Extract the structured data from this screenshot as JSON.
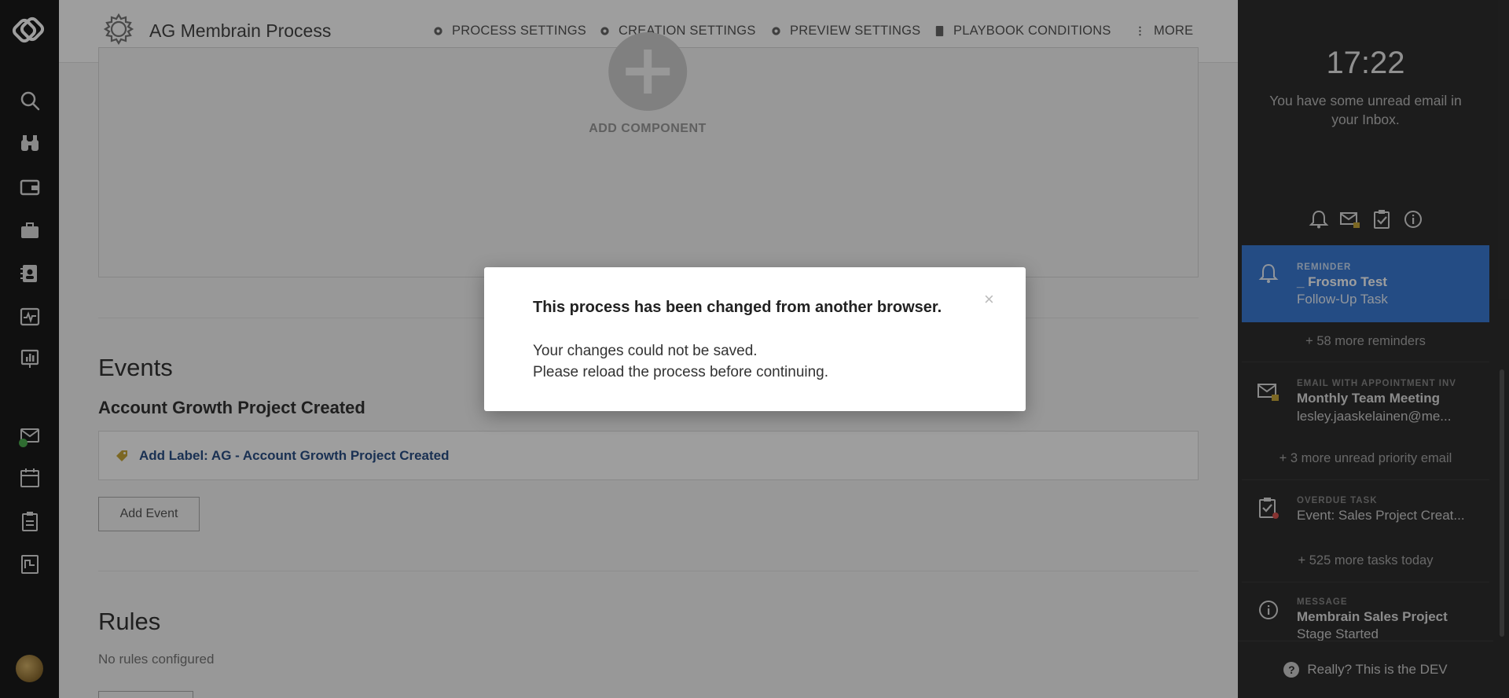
{
  "header": {
    "title": "AG Membrain Process",
    "nav": [
      {
        "label": "PROCESS SETTINGS",
        "icon": "gear-icon"
      },
      {
        "label": "CREATION SETTINGS",
        "icon": "gear-icon"
      },
      {
        "label": "PREVIEW SETTINGS",
        "icon": "gear-icon"
      },
      {
        "label": "PLAYBOOK CONDITIONS",
        "icon": "book-icon"
      },
      {
        "label": "MORE",
        "icon": "kebab-icon"
      }
    ]
  },
  "sidebar": {
    "icons": [
      "search-icon",
      "binoculars-icon",
      "wallet-icon",
      "briefcase-icon",
      "contact-card-icon",
      "activity-icon",
      "presentation-chart-icon",
      "mail-icon",
      "calendar-icon",
      "clipboard-icon",
      "report-icon"
    ]
  },
  "main": {
    "add_component": "ADD COMPONENT",
    "events_heading": "Events",
    "event_name": "Account Growth Project Created",
    "event_action": "Add Label: AG - Account Growth Project Created",
    "add_event": "Add Event",
    "rules_heading": "Rules",
    "rules_empty": "No rules configured"
  },
  "rightpanel": {
    "clock": "17:22",
    "unread": "You have some unread email in your Inbox.",
    "notifications": [
      {
        "kind": "REMINDER",
        "title": "_ Frosmo Test",
        "sub": "Follow-Up Task",
        "icon": "bell-icon"
      },
      {
        "kind": "EMAIL WITH APPOINTMENT INV",
        "title": "Monthly Team Meeting",
        "sub": "lesley.jaaskelainen@me...",
        "icon": "mail-lock-icon"
      },
      {
        "kind": "OVERDUE TASK",
        "title": "",
        "sub": "Event: Sales Project Creat...",
        "icon": "task-icon"
      },
      {
        "kind": "MESSAGE",
        "title": "Membrain Sales Project",
        "sub": "Stage Started",
        "icon": "info-icon"
      }
    ],
    "more_reminders": "+ 58 more reminders",
    "more_email": "+ 3 more unread priority email",
    "more_tasks": "+ 525 more tasks today",
    "footer": "Really? This is the DEV"
  },
  "modal": {
    "title": "This process has been changed from another browser.",
    "close": "×",
    "line1": "Your changes could not be saved.",
    "line2": "Please reload the process before continuing."
  },
  "colors": {
    "accent": "#3a7bd5",
    "link": "#2a4f86",
    "rail": "#1b1b1b",
    "panel": "#2e2e2e"
  }
}
